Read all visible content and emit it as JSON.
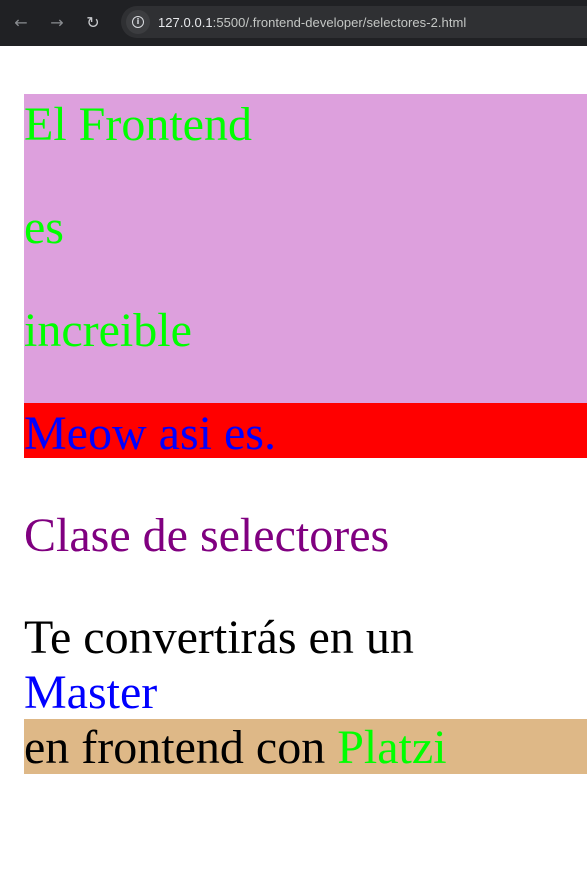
{
  "browser": {
    "url_host": "127.0.0.1",
    "url_rest": ":5500/.frontend-developer/selectores-2.html",
    "back_icon": "←",
    "forward_icon": "→",
    "reload_icon": "↻",
    "info_icon": "i"
  },
  "content": {
    "frontend_line1": "El Frontend",
    "frontend_line2": "es",
    "frontend_line3": "increible",
    "meow": "Meow asi es.",
    "clase": "Clase de selectores",
    "te_convertiras": "Te convertirás en un",
    "master": "Master",
    "en_frontend": "en frontend con ",
    "platzi": "Platzi"
  },
  "colors": {
    "purple_box": "#dda0dd",
    "green_text": "#00ff00",
    "red_box": "#ff0000",
    "blue_text": "#0000ff",
    "purple_text": "#800080",
    "tan_box": "#deb887"
  }
}
